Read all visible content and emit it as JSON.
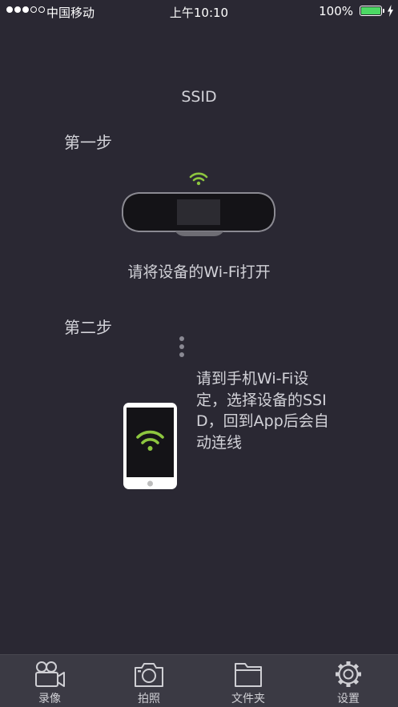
{
  "status_bar": {
    "carrier": "中国移动",
    "time": "上午10:10",
    "battery_percent": "100%",
    "signal_bars": 3,
    "signal_max": 5
  },
  "content": {
    "title": "SSID",
    "step1": {
      "label": "第一步",
      "text": "请将设备的Wi-Fi打开"
    },
    "step2": {
      "label": "第二步",
      "text": "请到手机Wi-Fi设定，选择设备的SSID，回到App后会自动连线"
    }
  },
  "tab_bar": {
    "tabs": [
      {
        "label": "录像",
        "icon": "video-camera-icon"
      },
      {
        "label": "拍照",
        "icon": "camera-icon"
      },
      {
        "label": "文件夹",
        "icon": "folder-icon"
      },
      {
        "label": "设置",
        "icon": "gear-icon"
      }
    ]
  },
  "colors": {
    "background": "#2a2833",
    "tab_bar": "#3b3a44",
    "wifi_green": "#8dc63f",
    "battery_green": "#4cd964"
  }
}
